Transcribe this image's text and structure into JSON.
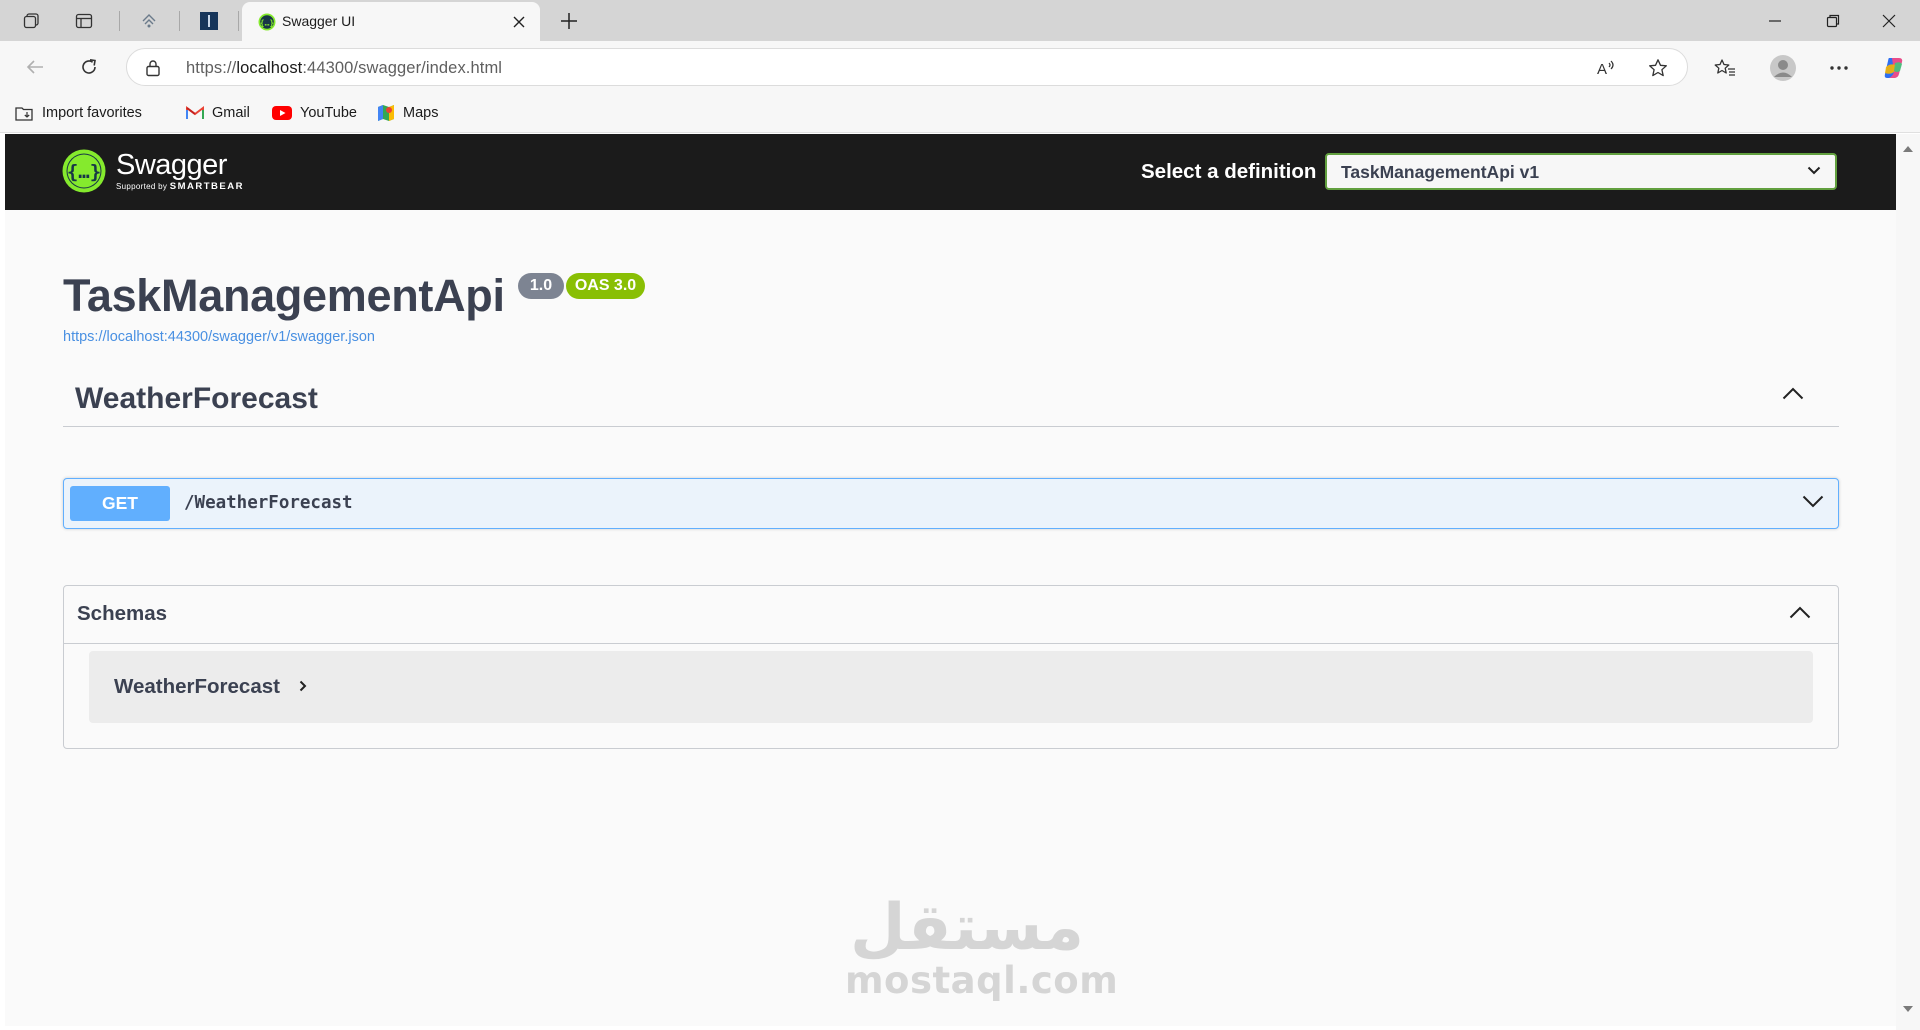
{
  "browser": {
    "tab_title": "Swagger UI",
    "url_prefix": "https://",
    "url_host": "localhost",
    "url_rest": ":44300/swagger/index.html",
    "bookmarks": [
      {
        "label": "Import favorites",
        "icon": "import-icon"
      },
      {
        "label": "Gmail",
        "icon": "gmail-icon"
      },
      {
        "label": "YouTube",
        "icon": "youtube-icon"
      },
      {
        "label": "Maps",
        "icon": "maps-icon"
      }
    ]
  },
  "swagger": {
    "logo_text": "Swagger",
    "logo_sub": "Supported by",
    "logo_brand": "SMARTBEAR",
    "select_label": "Select a definition",
    "selected_definition": "TaskManagementApi v1",
    "accent": "#89bf04",
    "topbar_bg": "#1b1b1b"
  },
  "info": {
    "title": "TaskManagementApi",
    "version": "1.0",
    "oas": "OAS 3.0",
    "spec_url": "https://localhost:44300/swagger/v1/swagger.json"
  },
  "tags": [
    {
      "name": "WeatherForecast",
      "operations": [
        {
          "method": "GET",
          "path": "/WeatherForecast",
          "color": "#61affe"
        }
      ]
    }
  ],
  "schemas": {
    "title": "Schemas",
    "models": [
      "WeatherForecast"
    ]
  },
  "watermark": {
    "arabic": "مستقل",
    "latin": "mostaql.com"
  }
}
